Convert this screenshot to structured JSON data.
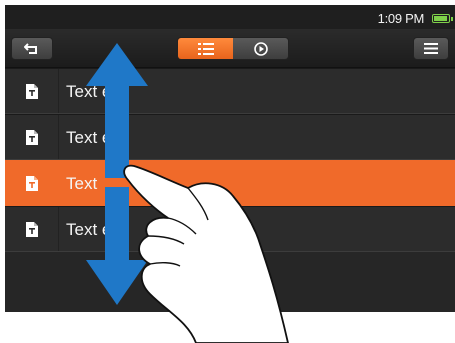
{
  "status": {
    "time": "1:09 PM",
    "battery_level": 0.85,
    "battery_color": "#7fd14a"
  },
  "toolbar": {
    "back_icon": "back-arrow-icon",
    "segments": [
      {
        "icon": "list-view-icon",
        "active": true
      },
      {
        "icon": "play-icon",
        "active": false
      }
    ],
    "menu_icon": "hamburger-menu-icon"
  },
  "list": {
    "items": [
      {
        "label": "Textfile 1",
        "visible_label": "Text  e 1",
        "icon": "text-file-icon",
        "selected": false
      },
      {
        "label": "Textfile 2",
        "visible_label": "Text  e 2",
        "icon": "text-file-icon",
        "selected": false
      },
      {
        "label": "Textfile 3",
        "visible_label": "Text",
        "icon": "text-file-icon",
        "selected": true
      },
      {
        "label": "Textfile 4",
        "visible_label": "Text  e 4",
        "icon": "text-file-icon",
        "selected": false
      }
    ]
  },
  "colors": {
    "accent": "#f06a2a",
    "arrow": "#1f78c8",
    "background": "#2a2a2a"
  },
  "gesture": {
    "type": "vertical-swipe",
    "icon": "finger-swipe-icon"
  }
}
